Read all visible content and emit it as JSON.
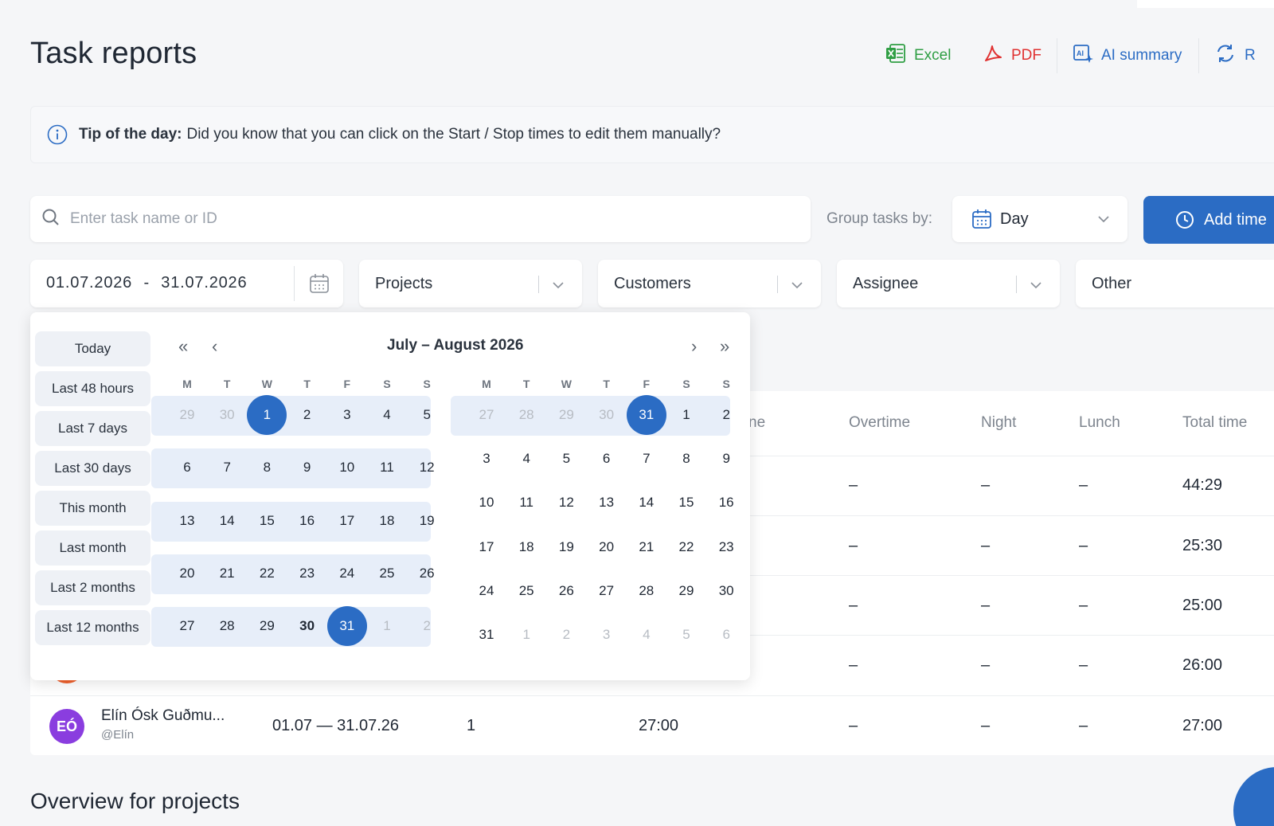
{
  "header": {
    "title": "Task reports",
    "excel_label": "Excel",
    "pdf_label": "PDF",
    "ai_label": "AI summary",
    "refresh_label": "R"
  },
  "colors": {
    "accent": "#2b6cc4",
    "excel": "#2f9e44",
    "pdf": "#e03131",
    "band": "#e7eef9"
  },
  "tip": {
    "bold": "Tip of the day:",
    "text": "Did you know that you can click on the Start / Stop times to edit them manually?"
  },
  "search": {
    "placeholder": "Enter task name or ID"
  },
  "group": {
    "label": "Group tasks by:",
    "value": "Day"
  },
  "add_button": {
    "label": "Add time"
  },
  "filters": {
    "date_from": "01.07.2026",
    "date_sep": "-",
    "date_to": "31.07.2026",
    "projects": "Projects",
    "customers": "Customers",
    "assignee": "Assignee",
    "other": "Other"
  },
  "table": {
    "headers": {
      "partial": "ne",
      "overtime": "Overtime",
      "night": "Night",
      "lunch": "Lunch",
      "total": "Total time"
    },
    "rows": [
      {
        "overtime": "–",
        "night": "–",
        "lunch": "–",
        "total": "44:29"
      },
      {
        "overtime": "–",
        "night": "–",
        "lunch": "–",
        "total": "25:30"
      },
      {
        "overtime": "–",
        "night": "–",
        "lunch": "–",
        "total": "25:00"
      },
      {
        "overtime": "–",
        "night": "–",
        "lunch": "–",
        "total": "26:00"
      },
      {
        "name": "Elín Ósk Guðmu...",
        "handle": "@Elín",
        "initials": "EÓ",
        "period": "01.07 — 31.07.26",
        "count": "1",
        "time": "27:00",
        "overtime": "–",
        "night": "–",
        "lunch": "–",
        "total": "27:00"
      }
    ]
  },
  "overview_title": "Overview for projects",
  "datepicker": {
    "title": "July – August 2026",
    "presets": [
      "Today",
      "Last 48 hours",
      "Last 7 days",
      "Last 30 days",
      "This month",
      "Last month",
      "Last 2 months",
      "Last 12 months"
    ],
    "weekdays": [
      "M",
      "T",
      "W",
      "T",
      "F",
      "S",
      "S"
    ],
    "month1": [
      [
        {
          "d": "29",
          "m": 1
        },
        {
          "d": "30",
          "m": 1
        },
        {
          "d": "1",
          "s": 1
        },
        {
          "d": "2"
        },
        {
          "d": "3"
        },
        {
          "d": "4"
        },
        {
          "d": "5"
        }
      ],
      [
        {
          "d": "6"
        },
        {
          "d": "7"
        },
        {
          "d": "8"
        },
        {
          "d": "9"
        },
        {
          "d": "10"
        },
        {
          "d": "11"
        },
        {
          "d": "12"
        }
      ],
      [
        {
          "d": "13"
        },
        {
          "d": "14"
        },
        {
          "d": "15"
        },
        {
          "d": "16"
        },
        {
          "d": "17"
        },
        {
          "d": "18"
        },
        {
          "d": "19"
        }
      ],
      [
        {
          "d": "20"
        },
        {
          "d": "21"
        },
        {
          "d": "22"
        },
        {
          "d": "23"
        },
        {
          "d": "24"
        },
        {
          "d": "25"
        },
        {
          "d": "26"
        }
      ],
      [
        {
          "d": "27"
        },
        {
          "d": "28"
        },
        {
          "d": "29"
        },
        {
          "d": "30",
          "b": 1
        },
        {
          "d": "31",
          "s": 1
        },
        {
          "d": "1",
          "m": 1
        },
        {
          "d": "2",
          "m": 1
        }
      ]
    ],
    "month2": [
      [
        {
          "d": "27",
          "m": 1
        },
        {
          "d": "28",
          "m": 1
        },
        {
          "d": "29",
          "m": 1
        },
        {
          "d": "30",
          "m": 1
        },
        {
          "d": "31",
          "s": 1
        },
        {
          "d": "1"
        },
        {
          "d": "2"
        }
      ],
      [
        {
          "d": "3"
        },
        {
          "d": "4"
        },
        {
          "d": "5"
        },
        {
          "d": "6"
        },
        {
          "d": "7"
        },
        {
          "d": "8"
        },
        {
          "d": "9"
        }
      ],
      [
        {
          "d": "10"
        },
        {
          "d": "11"
        },
        {
          "d": "12"
        },
        {
          "d": "13"
        },
        {
          "d": "14"
        },
        {
          "d": "15"
        },
        {
          "d": "16"
        }
      ],
      [
        {
          "d": "17"
        },
        {
          "d": "18"
        },
        {
          "d": "19"
        },
        {
          "d": "20"
        },
        {
          "d": "21"
        },
        {
          "d": "22"
        },
        {
          "d": "23"
        }
      ],
      [
        {
          "d": "24"
        },
        {
          "d": "25"
        },
        {
          "d": "26"
        },
        {
          "d": "27"
        },
        {
          "d": "28"
        },
        {
          "d": "29"
        },
        {
          "d": "30"
        }
      ],
      [
        {
          "d": "31"
        },
        {
          "d": "1",
          "m": 1
        },
        {
          "d": "2",
          "m": 1
        },
        {
          "d": "3",
          "m": 1
        },
        {
          "d": "4",
          "m": 1
        },
        {
          "d": "5",
          "m": 1
        },
        {
          "d": "6",
          "m": 1
        }
      ]
    ]
  }
}
